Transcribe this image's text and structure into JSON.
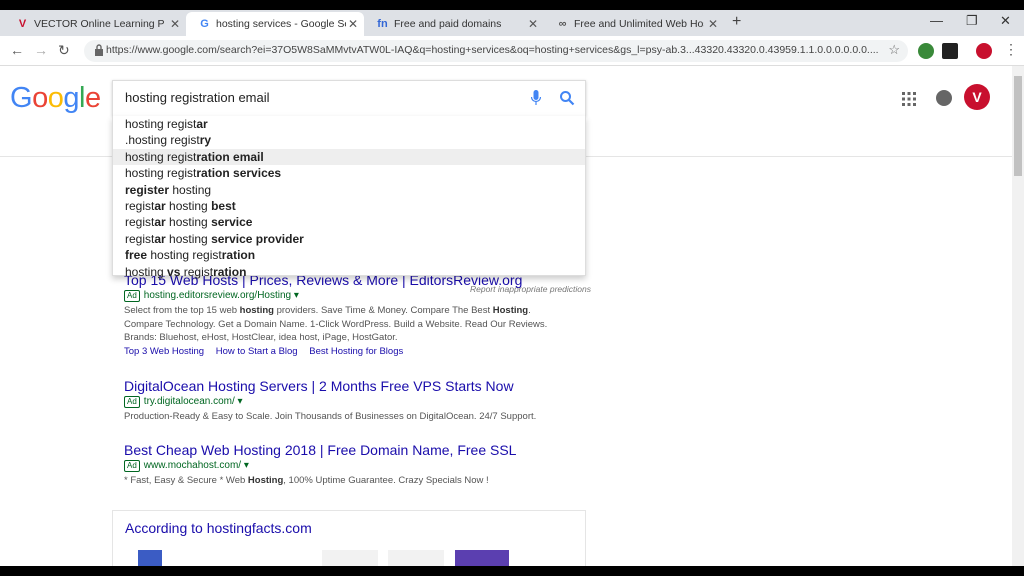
{
  "tabs": [
    {
      "title": "VECTOR Online Learning Platform",
      "favicon": "vector-logo-icon"
    },
    {
      "title": "hosting services - Google Search",
      "favicon": "google-g-icon"
    },
    {
      "title": "Free and paid domains",
      "favicon": "freenom-icon"
    },
    {
      "title": "Free and Unlimited Web Hosting",
      "favicon": "infinity-icon"
    }
  ],
  "address_bar": {
    "url": "https://www.google.com/search?ei=37O5W8SaMMvtvATW0L-IAQ&q=hosting+services&oq=hosting+services&gs_l=psy-ab.3...43320.43320.0.43959.1.1.0.0.0.0.0.0...."
  },
  "logo": "Google",
  "search": {
    "query": "hosting registration email"
  },
  "suggestions": [
    {
      "pre": "hosting regist",
      "bold": "ar",
      "post": ""
    },
    {
      "pre": ".hosting regist",
      "bold": "ry",
      "post": ""
    },
    {
      "pre": "hosting regist",
      "bold": "ration email",
      "post": ""
    },
    {
      "pre": "hosting regist",
      "bold": "ration services",
      "post": ""
    },
    {
      "pre": "",
      "bold": "register",
      "post": " hosting"
    },
    {
      "pre": "regist",
      "bold": "ar",
      "post": " hosting ",
      "bold2": "best"
    },
    {
      "pre": "regist",
      "bold": "ar",
      "post": " hosting ",
      "bold2": "service"
    },
    {
      "pre": "regist",
      "bold": "ar",
      "post": " hosting ",
      "bold2": "service provider"
    },
    {
      "pre": "",
      "bold": "free",
      "post": " hosting regist",
      "bold2": "ration"
    },
    {
      "pre": "hosting ",
      "bold": "vs",
      "post": " regist",
      "bold2": "ration"
    }
  ],
  "report_text": "Report inappropriate predictions",
  "results": [
    {
      "title": "Top 15 Web Hosts | Prices, Reviews & More | EditorsReview.org",
      "ad": "Ad",
      "url": "hosting.editorsreview.org/Hosting",
      "desc1": "Select from the top 15 web ",
      "desc1b": "hosting",
      "desc1c": " providers. Save Time & Money. Compare The Best ",
      "desc1d": "Hosting",
      "desc1e": ".",
      "desc2": "Compare Technology. Get a Domain Name. 1-Click WordPress. Build a Website. Read Our Reviews.",
      "desc3": "Brands: Bluehost, eHost, HostClear, idea host, iPage, HostGator.",
      "sitelinks": [
        "Top 3 Web Hosting",
        "How to Start a Blog",
        "Best Hosting for Blogs"
      ]
    },
    {
      "title": "DigitalOcean Hosting Servers | 2 Months Free VPS Starts Now",
      "ad": "Ad",
      "url": "try.digitalocean.com/",
      "desc1": "Production-Ready & Easy to Scale. Join Thousands of Businesses on DigitalOcean. 24/7 Support."
    },
    {
      "title": "Best Cheap Web Hosting 2018 | Free Domain Name, Free SSL",
      "ad": "Ad",
      "url": "www.mochahost.com/",
      "desc1": "* Fast, Easy & Secure * Web ",
      "desc1b": "Hosting",
      "desc1c": ", 100% Uptime Guarantee. Crazy Specials Now !"
    }
  ],
  "according": "According to hostingfacts.com",
  "colors": {
    "link": "#1a0dab",
    "url": "#006621",
    "brand": "#c8102e"
  }
}
